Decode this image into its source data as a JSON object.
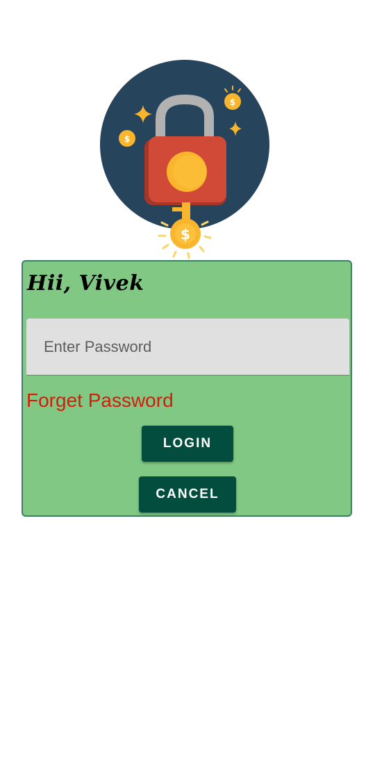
{
  "illustration": {
    "icon": "unlocked-padlock-with-key-and-coins",
    "colors": {
      "background_circle": "#27445d",
      "lock_body": "#d04a37",
      "shackle": "#b2b2b2",
      "gold": "#f9b52c"
    }
  },
  "login_card": {
    "greeting": "Hii, Vivek",
    "password": {
      "placeholder": "Enter Password",
      "value": ""
    },
    "forget_password_label": "Forget Password",
    "login_label": "LOGIN",
    "cancel_label": "CANCEL"
  },
  "colors": {
    "card_background": "#80c883",
    "card_border": "#3f7d6b",
    "button_background": "#034d3e",
    "link": "#d31d0b"
  }
}
